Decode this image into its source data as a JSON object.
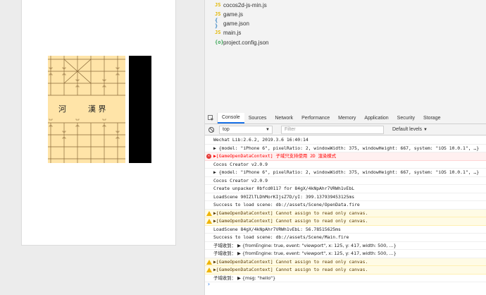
{
  "file_tree": {
    "items": [
      {
        "icon": "js",
        "label": "cocos2d-js-min.js"
      },
      {
        "icon": "js",
        "label": "game.js"
      },
      {
        "icon": "json",
        "label": "game.json"
      },
      {
        "icon": "js",
        "label": "main.js"
      },
      {
        "icon": "cfg",
        "label": "project.config.json"
      }
    ]
  },
  "board": {
    "river_left": "河",
    "river_right": "漢 界",
    "fragment": "ﾟ"
  },
  "devtools": {
    "tabs": [
      "Console",
      "Sources",
      "Network",
      "Performance",
      "Memory",
      "Application",
      "Security",
      "Storage"
    ],
    "active_tab": "Console",
    "context": "top",
    "filter_placeholder": "Filter",
    "levels": "Default levels"
  },
  "console": {
    "lines": [
      {
        "level": "log",
        "text": "Wechat Lib:2.6.2, 2019.3.6 16:40:14"
      },
      {
        "level": "log",
        "text": "▶ {model: \"iPhone 6\", pixelRatio: 2, windowWidth: 375, windowHeight: 667, system: \"iOS 10.0.1\", …}"
      },
      {
        "level": "error",
        "text": "▶[GameOpenDataContext] 子域只支持使用 2D 渲染模式"
      },
      {
        "level": "log",
        "text": "Cocos Creator v2.0.9"
      },
      {
        "level": "log",
        "text": "▶ {model: \"iPhone 6\", pixelRatio: 2, windowWidth: 375, windowHeight: 667, system: \"iOS 10.0.1\", …}"
      },
      {
        "level": "log",
        "text": "Cocos Creator v2.0.9"
      },
      {
        "level": "log",
        "text": "Create unpacker 0bfcd0117 for 84gX/4kNpAhr7VRWh1vEbL"
      },
      {
        "level": "log",
        "text": "LoadScene 90IZlTLDhMorKIjsZ7D/yI: 399.137939453125ms"
      },
      {
        "level": "log",
        "text": "Success to load scene: db://assets/Scene/OpenData.fire"
      },
      {
        "level": "warn",
        "text": "▶[GameOpenDataContext] Cannot assign to read only canvas."
      },
      {
        "level": "warn",
        "text": "▶[GameOpenDataContext] Cannot assign to read only canvas."
      },
      {
        "level": "log",
        "text": "LoadScene 84gX/4kNpAhr7VRWh1vEbL: 56.78515625ms"
      },
      {
        "level": "log",
        "text": "Success to load scene: db://assets/Scene/Main.fire"
      },
      {
        "level": "log",
        "text": "子域收到：  ▶ {fromEngine: true, event: \"viewport\", x: 125, y: 417, width: 500, …}"
      },
      {
        "level": "log",
        "text": "子域收到：  ▶ {fromEngine: true, event: \"viewport\", x: 125, y: 417, width: 500, …}"
      },
      {
        "level": "warn",
        "text": "▶[GameOpenDataContext] Cannot assign to read only canvas."
      },
      {
        "level": "warn",
        "text": "▶[GameOpenDataContext] Cannot assign to read only canvas."
      },
      {
        "level": "log",
        "text": "子域收到：  ▶ {msg: \"hello\"}"
      }
    ],
    "prompt": "›"
  },
  "colors": {
    "board": "#ffe4a8",
    "error_bg": "#fff0f0",
    "warn_bg": "#fffbe5",
    "accent": "#1a73e8"
  }
}
